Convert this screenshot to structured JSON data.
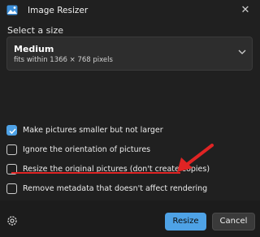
{
  "window": {
    "title": "Image Resizer",
    "close_glyph": "✕"
  },
  "size_section": {
    "label": "Select a size",
    "selected": {
      "name": "Medium",
      "description": "fits within 1366 × 768 pixels"
    }
  },
  "options": [
    {
      "label": "Make pictures smaller but not larger",
      "checked": true
    },
    {
      "label": "Ignore the orientation of pictures",
      "checked": false
    },
    {
      "label": "Resize the original pictures (don't create copies)",
      "checked": false
    },
    {
      "label": "Remove metadata that doesn't affect rendering",
      "checked": false
    }
  ],
  "buttons": {
    "resize": "Resize",
    "cancel": "Cancel"
  },
  "colors": {
    "accent": "#4ea2e6",
    "annotation": "#e02424",
    "background": "#202020"
  },
  "icons": {
    "app": "image-icon",
    "settings": "gear-icon",
    "dropdown": "chevron-down-icon",
    "close": "close-icon"
  }
}
